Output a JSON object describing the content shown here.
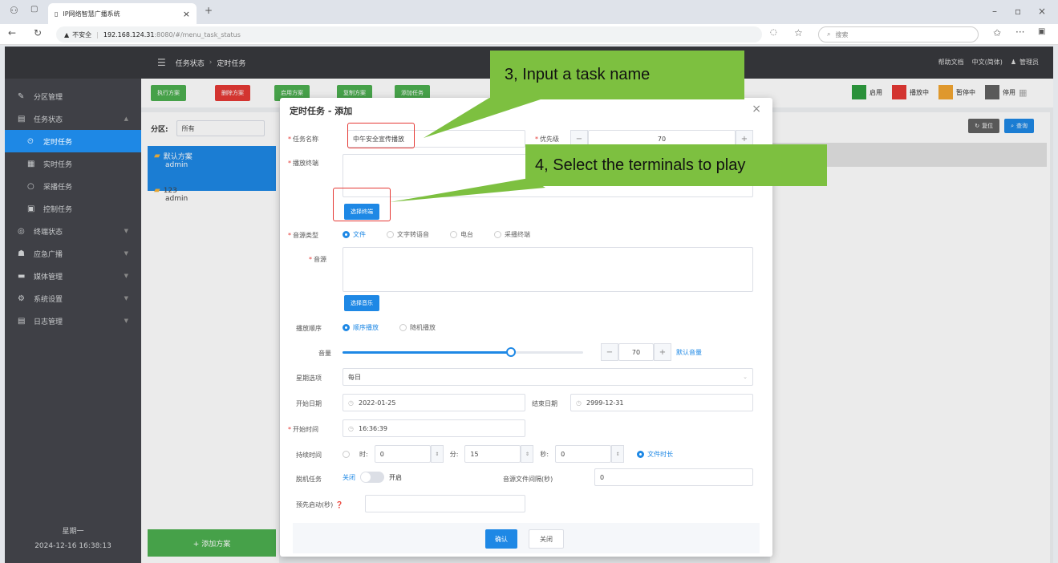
{
  "browser": {
    "tab_title": "IP网络智慧广播系统",
    "tab_close": "×",
    "new_tab": "+",
    "insecure_label": "不安全",
    "url_host": "192.168.124.31",
    "url_path": ":8080/#/menu_task_status",
    "search_placeholder": "搜索",
    "more": "···"
  },
  "sidebar": {
    "items": [
      {
        "label": "分区管理",
        "icon": "✎"
      },
      {
        "label": "任务状态",
        "icon": "▤"
      },
      {
        "label": "定时任务",
        "icon": "⏲"
      },
      {
        "label": "实时任务",
        "icon": "▦"
      },
      {
        "label": "采播任务",
        "icon": "○"
      },
      {
        "label": "控制任务",
        "icon": "▣"
      },
      {
        "label": "终端状态",
        "icon": "◎"
      },
      {
        "label": "应急广播",
        "icon": "☗"
      },
      {
        "label": "媒体管理",
        "icon": "▬"
      },
      {
        "label": "系统设置",
        "icon": "⚙"
      },
      {
        "label": "日志管理",
        "icon": "▤"
      }
    ],
    "footer_day": "星期一",
    "footer_time": "2024-12-16 16:38:13"
  },
  "topbar": {
    "menu_icon": "☰",
    "crumb1": "任务状态",
    "crumb_sep": "›",
    "crumb2": "定时任务",
    "help": "帮助文档",
    "lang": "中文(简体)",
    "user": "管理员"
  },
  "toolbar": {
    "buttons": [
      "执行方案",
      "删除方案",
      "启用方案",
      "复制方案",
      "添加任务"
    ],
    "legend": [
      {
        "label": "启用",
        "color": "#2e9e3f"
      },
      {
        "label": "播放中",
        "color": "#e53935"
      },
      {
        "label": "暂停中",
        "color": "#f2a531"
      },
      {
        "label": "停用",
        "color": "#616161"
      }
    ]
  },
  "filter": {
    "label": "分区:",
    "value": "所有",
    "reset": "复位",
    "query": "查询"
  },
  "plans": [
    {
      "name": "默认方案",
      "owner": "admin"
    },
    {
      "name": "123",
      "owner": "admin"
    }
  ],
  "add_plan": "+ 添加方案",
  "dialog": {
    "title": "定时任务 - 添加",
    "task_name_label": "任务名称",
    "task_name_value": "中午安全宣传播放",
    "priority_label": "优先级",
    "priority_value": "70",
    "terminal_label": "播放终端",
    "select_terminal": "选择终端",
    "source_type_label": "音源类型",
    "source_types": [
      "文件",
      "文字转语音",
      "电台",
      "采播终端"
    ],
    "source_label": "音源",
    "select_music": "选择音乐",
    "order_label": "播放顺序",
    "orders": [
      "顺序播放",
      "随机播放"
    ],
    "volume_label": "音量",
    "volume_value": "70",
    "volume_level": 0.7,
    "default_volume": "默认音量",
    "week_label": "星期选项",
    "week_value": "每日",
    "start_date_label": "开始日期",
    "start_date": "2022-01-25",
    "end_date_label": "结束日期",
    "end_date": "2999-12-31",
    "start_time_label": "开始时间",
    "start_time": "16:36:39",
    "duration_label": "持续时间",
    "hour_label": "时:",
    "hour_value": "0",
    "minute_label": "分:",
    "minute_value": "15",
    "second_label": "秒:",
    "second_value": "0",
    "file_duration": "文件时长",
    "offline_label": "脱机任务",
    "offline_off": "关闭",
    "offline_on": "开启",
    "interval_label": "音源文件间隔(秒)",
    "interval_value": "0",
    "prestart_label": "预先启动(秒)",
    "confirm": "确认",
    "close": "关闭"
  },
  "annotations": {
    "step3": "3, Input a task name",
    "step4": "4, Select the terminals to play"
  }
}
